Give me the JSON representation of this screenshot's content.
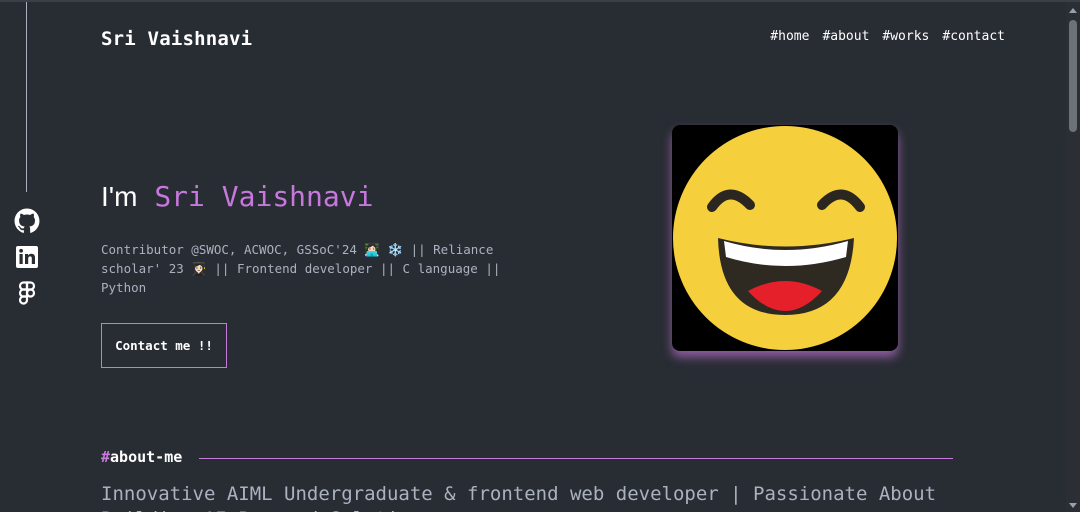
{
  "header": {
    "logo": "Sri Vaishnavi",
    "nav": [
      {
        "label": "#home"
      },
      {
        "label": "#about"
      },
      {
        "label": "#works"
      },
      {
        "label": "#contact"
      }
    ]
  },
  "social": [
    {
      "icon": "github-icon"
    },
    {
      "icon": "linkedin-icon"
    },
    {
      "icon": "figma-icon"
    }
  ],
  "hero": {
    "greeting": "I'm",
    "name": "Sri Vaishnavi",
    "description": "Contributor @SWOC, ACWOC, GSSoC'24 👩🏻‍💻 ❄️ || Reliance scholar' 23 👩🏻‍🎓 || Frontend developer || C language || Python",
    "contact_label": "Contact me !!",
    "avatar_icon": "laughing-emoji-icon"
  },
  "about": {
    "hash": "#",
    "heading": "about-me",
    "text": "Innovative AIML Undergraduate & frontend web developer | Passionate About Building AI-Powered Solutions"
  },
  "colors": {
    "background": "#282c33",
    "accent": "#c778dd",
    "muted_text": "#abb2bf",
    "text": "#ffffff"
  }
}
